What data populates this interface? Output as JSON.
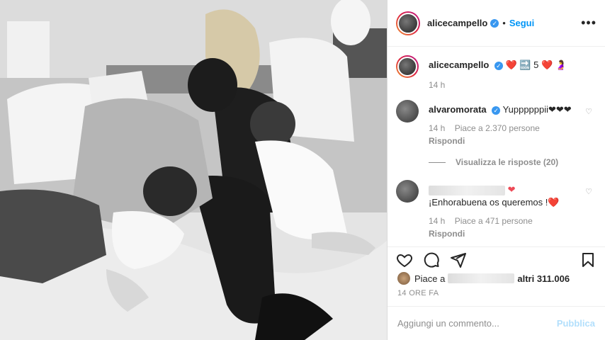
{
  "header": {
    "username": "alicecampello",
    "separator": "•",
    "follow_label": "Segui",
    "more_label": "•••"
  },
  "caption": {
    "username": "alicecampello",
    "text": "❤️ 🔜 5 ❤️ 🤰",
    "time": "14 h"
  },
  "comments": [
    {
      "username": "alvaromorata",
      "text": "Yuppppppii❤❤❤",
      "time": "14 h",
      "likes": "Piace a 2.370 persone",
      "reply": "Rispondi",
      "view_replies": "Visualizza le risposte (20)"
    },
    {
      "username": "",
      "text": "¡Enhorabuena os queremos !❤️",
      "time": "14 h",
      "likes": "Piace a 471 persone",
      "reply": "Rispondi"
    }
  ],
  "likes_summary": {
    "prefix": "Piace a",
    "suffix": "altri 311.006"
  },
  "post_time": "14 ORE FA",
  "add_comment": {
    "placeholder": "Aggiungi un commento...",
    "publish_label": "Pubblica"
  },
  "icons": [
    "heart-icon",
    "comment-icon",
    "share-icon",
    "bookmark-icon",
    "verified-icon"
  ],
  "colors": {
    "accent": "#0095f6",
    "publish_disabled": "#b2dffc",
    "verified": "#3897f0"
  }
}
